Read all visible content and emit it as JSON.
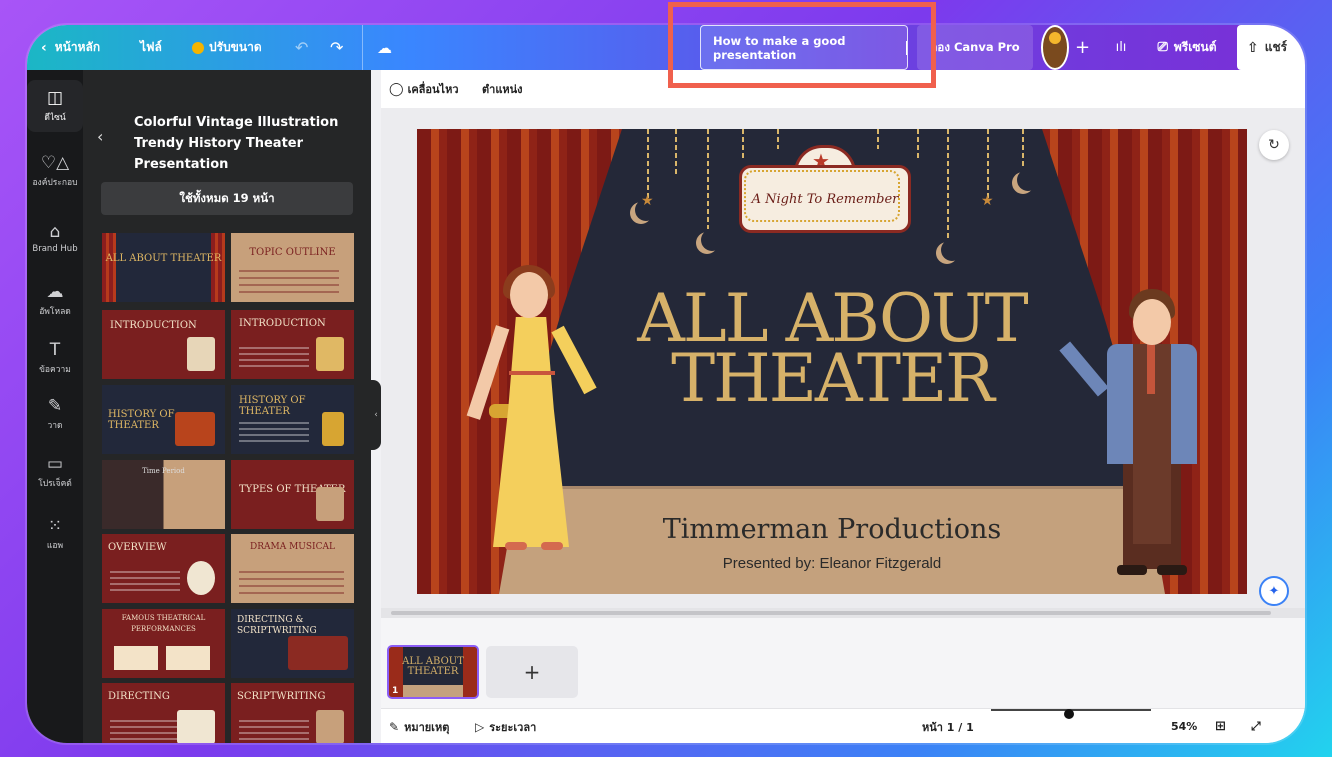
{
  "topbar": {
    "back_label": "หน้าหลัก",
    "file_label": "ไฟล์",
    "resize_label": "ปรับขนาด",
    "doc_title": "How to make a good presentation",
    "try_pro_label": "ลอง Canva Pro",
    "present_label": "พรีเซนต์",
    "share_label": "แชร์"
  },
  "rail": {
    "items": [
      {
        "label": "ดีไซน์",
        "icon": "layout-icon"
      },
      {
        "label": "องค์ประกอบ",
        "icon": "shapes-icon"
      },
      {
        "label": "Brand Hub",
        "icon": "brand-icon"
      },
      {
        "label": "อัพโหลด",
        "icon": "upload-cloud-icon"
      },
      {
        "label": "ข้อความ",
        "icon": "text-icon"
      },
      {
        "label": "วาด",
        "icon": "draw-icon"
      },
      {
        "label": "โปรเจ็คต์",
        "icon": "folder-icon"
      },
      {
        "label": "แอพ",
        "icon": "apps-icon"
      }
    ]
  },
  "panel": {
    "template_title": "Colorful Vintage Illustration Trendy History Theater Presentation",
    "apply_all_label": "ใช้ทั้งหมด 19 หน้า",
    "thumbnails": [
      {
        "title": "ALL ABOUT THEATER",
        "style": "navy"
      },
      {
        "title": "TOPIC OUTLINE",
        "style": "tan"
      },
      {
        "title": "INTRODUCTION",
        "style": "maroon"
      },
      {
        "title": "INTRODUCTION",
        "style": "maroon"
      },
      {
        "title": "HISTORY OF THEATER",
        "style": "navy"
      },
      {
        "title": "HISTORY OF THEATER",
        "style": "navy"
      },
      {
        "title": "Time Period",
        "style": "navy"
      },
      {
        "title": "TYPES OF THEATER",
        "style": "maroon"
      },
      {
        "title": "OVERVIEW",
        "style": "maroon"
      },
      {
        "title": "DRAMA MUSICAL",
        "style": "tan"
      },
      {
        "title": "FAMOUS THEATRICAL PERFORMANCES",
        "style": "maroon"
      },
      {
        "title": "DIRECTING & SCRIPTWRITING",
        "style": "navy"
      },
      {
        "title": "DIRECTING",
        "style": "maroon"
      },
      {
        "title": "SCRIPTWRITING",
        "style": "maroon"
      }
    ]
  },
  "context_toolbar": {
    "animate_label": "เคลื่อนไหว",
    "position_label": "ตำแหน่ง"
  },
  "slide": {
    "sign_text": "A Night To Remember",
    "title": "ALL ABOUT THEATER",
    "company": "Timmerman Productions",
    "presenter": "Presented by: Eleanor Fitzgerald"
  },
  "pages": {
    "thumb_title": "ALL ABOUT THEATER",
    "thumb_number": "1"
  },
  "footer": {
    "notes_label": "หมายเหตุ",
    "timer_label": "ระยะเวลา",
    "page_indicator": "หน้า 1 / 1",
    "zoom": "54%",
    "zoom_fraction": 0.54
  }
}
